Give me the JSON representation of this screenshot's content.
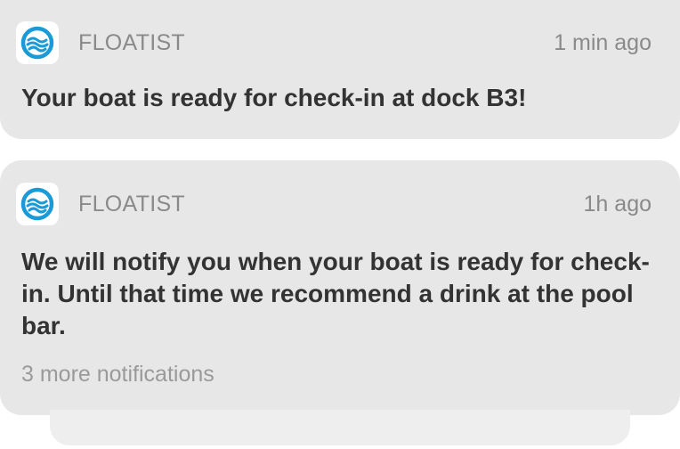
{
  "notifications": [
    {
      "app_name": "FLOATIST",
      "time": "1 min ago",
      "message": "Your boat is ready for check-in at dock B3!"
    },
    {
      "app_name": "FLOATIST",
      "time": "1h ago",
      "message": "We will notify you when your boat is ready for check-in. Until that time we recommend a drink at the pool bar."
    }
  ],
  "more_notifications": "3 more notifications",
  "icon": "lifebuoy-waves-icon",
  "colors": {
    "accent": "#1a9bd7",
    "card_bg": "#e7e7e7",
    "message_text": "#333333",
    "muted_text": "#8a8a8a"
  }
}
